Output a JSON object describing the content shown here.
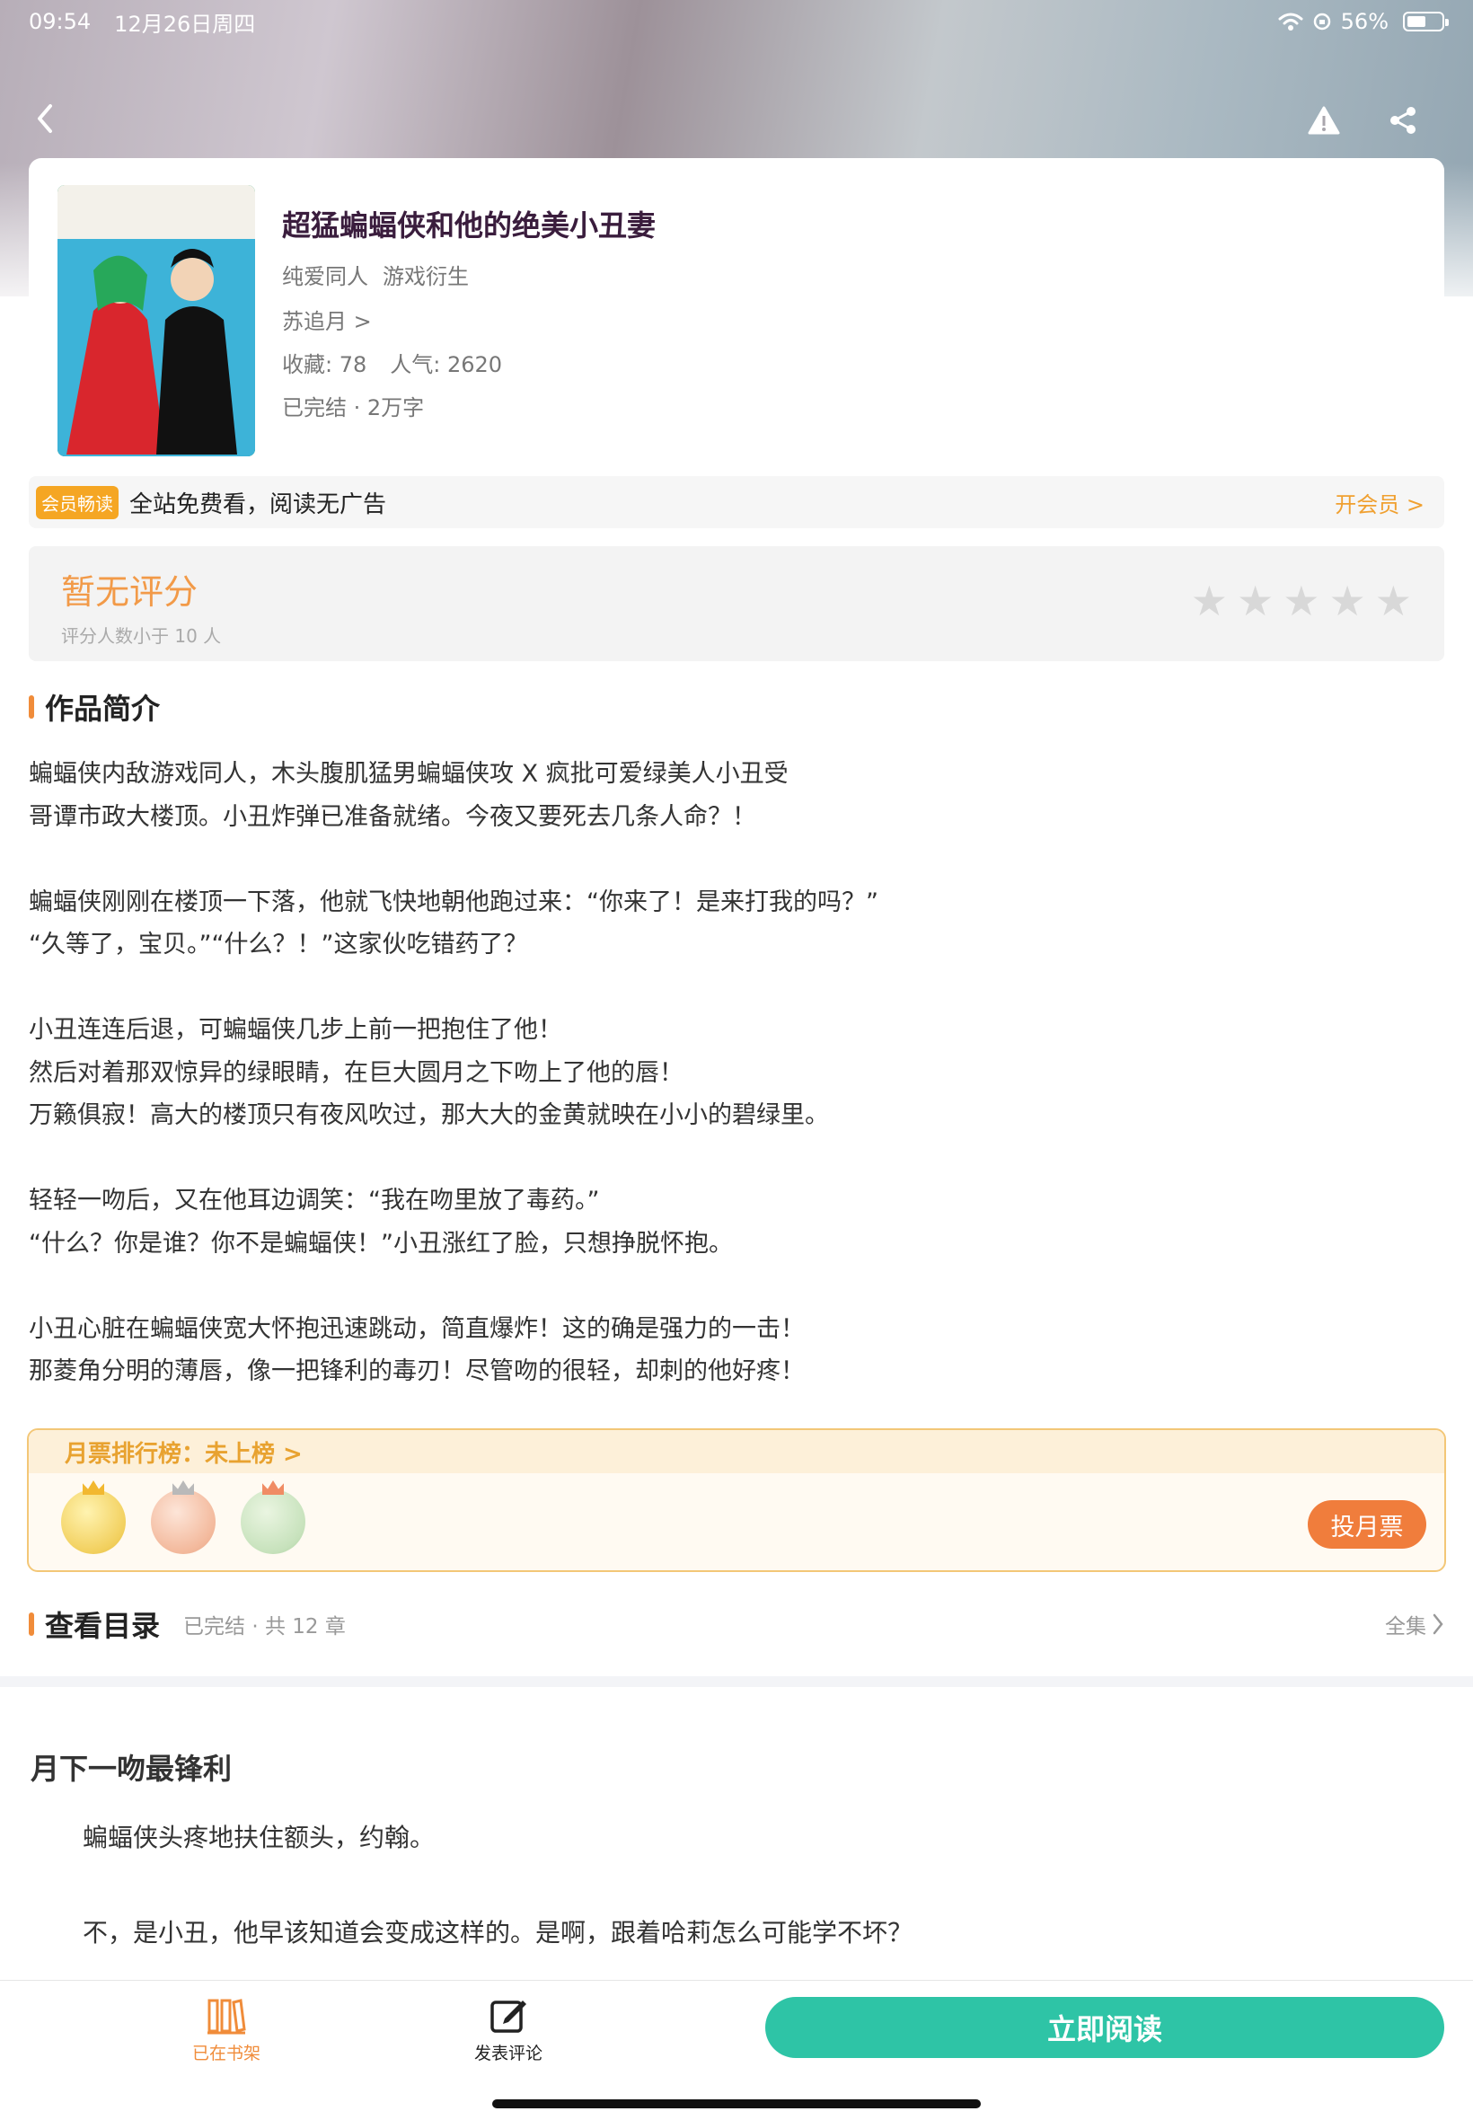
{
  "status_bar": {
    "time": "09:54",
    "date": "12月26日周四",
    "battery": "56%",
    "battery_level": 0.56
  },
  "book": {
    "title": "超猛蝙蝠侠和他的绝美小丑妻",
    "tags": [
      "纯爱同人",
      "游戏衍生"
    ],
    "author": "苏追月 >",
    "favorites": "收藏: 78",
    "popularity": "人气: 2620",
    "status": "已完结 · 2万字",
    "cover_icon": "cover-illustration"
  },
  "vip": {
    "badge": "会员畅读",
    "text": "全站免费看，阅读无广告",
    "link": "开会员 >"
  },
  "rating": {
    "main": "暂无评分",
    "sub": "评分人数小于 10 人",
    "stars_filled": 0,
    "stars_total": 5
  },
  "synopsis": {
    "title": "作品简介",
    "lines": [
      "蝙蝠侠内敌游戏同人，木头腹肌猛男蝙蝠侠攻 X 疯批可爱绿美人小丑受",
      "哥谭市政大楼顶。小丑炸弹已准备就绪。今夜又要死去几条人命？！",
      "",
      "蝙蝠侠刚刚在楼顶一下落，他就飞快地朝他跑过来：“你来了！是来打我的吗？”",
      "“久等了，宝贝。”“什么？！”这家伙吃错药了？",
      "",
      "小丑连连后退，可蝙蝠侠几步上前一把抱住了他！",
      "然后对着那双惊异的绿眼睛，在巨大圆月之下吻上了他的唇！",
      "万籁俱寂！高大的楼顶只有夜风吹过，那大大的金黄就映在小小的碧绿里。",
      "",
      "轻轻一吻后，又在他耳边调笑：“我在吻里放了毒药。”",
      "“什么？你是谁？你不是蝙蝠侠！”小丑涨红了脸，只想挣脱怀抱。",
      "",
      "小丑心脏在蝙蝠侠宽大怀抱迅速跳动，简直爆炸！这的确是强力的一击！",
      "那菱角分明的薄唇，像一把锋利的毒刃！尽管吻的很轻，却刺的他好疼！"
    ]
  },
  "monthly_ticket": {
    "label": "月票排行榜：未上榜 >",
    "vote": "投月票"
  },
  "toc": {
    "title": "查看目录",
    "meta": "已完结 · 共 12 章",
    "all": "全集"
  },
  "chapter": {
    "title": "月下一吻最锋利",
    "paragraphs": [
      "蝙蝠侠头疼地扶住额头，约翰。",
      "不，是小丑，他早该知道会变成这样的。是啊，跟着哈莉怎么可能学不坏？"
    ]
  },
  "bottom_bar": {
    "shelf": "已在书架",
    "comment": "发表评论",
    "read": "立即阅读"
  },
  "colors": {
    "accent": "#f08c3a",
    "teal": "#2ec4a6",
    "gold": "#e8a230"
  }
}
